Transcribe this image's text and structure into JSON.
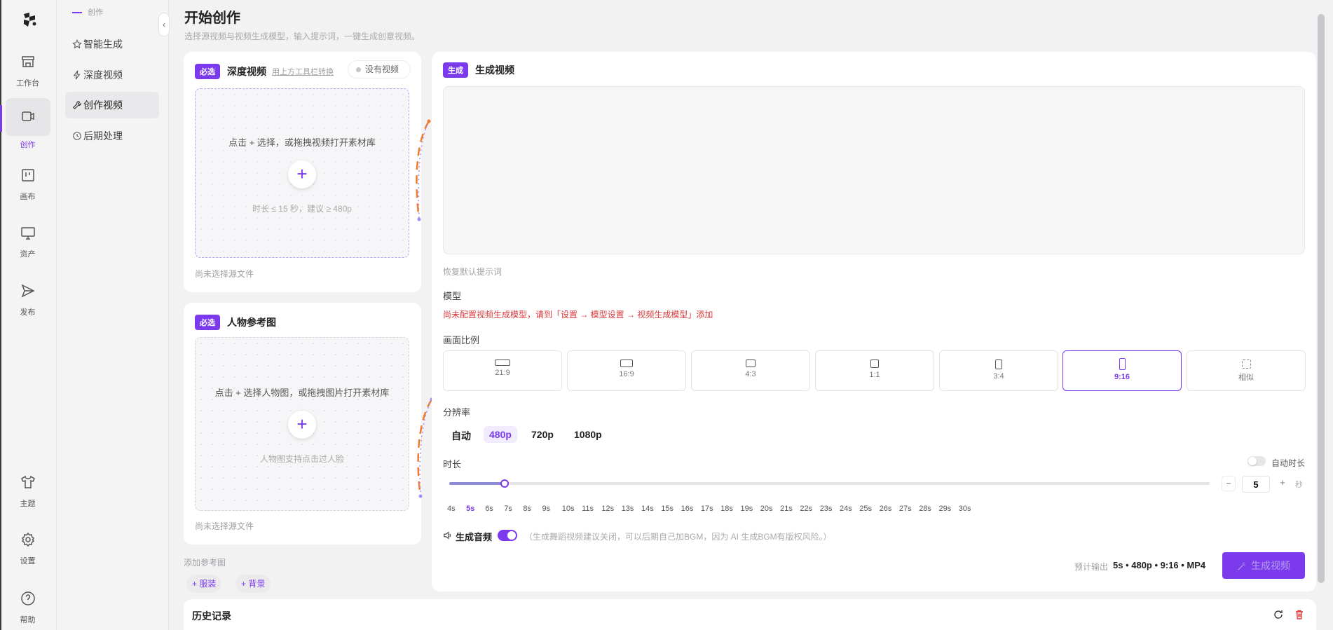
{
  "rail": {
    "items": [
      {
        "label": "工作台",
        "icon": "store-icon"
      },
      {
        "label": "创作",
        "icon": "video-icon",
        "active": true
      },
      {
        "label": "画布",
        "icon": "canvas-icon"
      },
      {
        "label": "资产",
        "icon": "monitor-icon"
      },
      {
        "label": "发布",
        "icon": "send-icon"
      }
    ],
    "bottom": [
      {
        "label": "主题",
        "icon": "shirt-icon"
      },
      {
        "label": "设置",
        "icon": "gear-icon"
      },
      {
        "label": "帮助",
        "icon": "help-icon"
      }
    ]
  },
  "subnav": {
    "section": "创作",
    "items": [
      {
        "label": "智能生成",
        "icon": "star-icon"
      },
      {
        "label": "深度视频",
        "icon": "bolt-icon"
      },
      {
        "label": "创作视频",
        "icon": "wrench-icon",
        "active": true
      },
      {
        "label": "后期处理",
        "icon": "clock-icon"
      }
    ],
    "collapse_glyph": "‹"
  },
  "header": {
    "title": "开始创作",
    "subtitle": "选择源视频与视频生成模型，输入提示词，一键生成创意视频。"
  },
  "source_card": {
    "tag": "必选",
    "title": "深度视频",
    "link": "用上方工具栏转换",
    "status": "没有视频",
    "drop_text": "点击 + 选择，或拖拽视频打开素材库",
    "drop_hint": "时长 ≤ 15 秒，建议 ≥ 480p",
    "footer": "尚未选择源文件"
  },
  "person_card": {
    "tag": "必选",
    "title": "人物参考图",
    "drop_text": "点击 + 选择人物图，或拖拽图片打开素材库",
    "drop_hint": "人物图支持点击过人脸",
    "footer": "尚未选择源文件"
  },
  "extra_refs": {
    "label": "添加参考图",
    "buttons": [
      "服装",
      "背景"
    ]
  },
  "generate": {
    "tag": "生成",
    "title": "生成视频",
    "prompt_value": "",
    "reset_prompt": "恢复默认提示词",
    "model_label": "模型",
    "model_warning": "尚未配置视频生成模型，请到「设置 → 模型设置 → 视频生成模型」添加",
    "ratio_label": "画面比例",
    "ratios": [
      "21:9",
      "16:9",
      "4:3",
      "1:1",
      "3:4",
      "9:16",
      "相似"
    ],
    "ratio_selected": "9:16",
    "resolution_label": "分辨率",
    "resolutions": [
      "自动",
      "480p",
      "720p",
      "1080p"
    ],
    "resolution_selected": "480p",
    "duration_label": "时长",
    "auto_duration_label": "自动时长",
    "auto_duration_on": false,
    "duration_value": "5",
    "duration_unit": "秒",
    "duration_min": 4,
    "duration_max": 30,
    "duration_ticks": [
      "4s",
      "5s",
      "6s",
      "7s",
      "8s",
      "9s",
      "10s",
      "11s",
      "12s",
      "13s",
      "14s",
      "15s",
      "16s",
      "17s",
      "18s",
      "19s",
      "20s",
      "21s",
      "22s",
      "23s",
      "24s",
      "25s",
      "26s",
      "27s",
      "28s",
      "29s",
      "30s"
    ],
    "duration_selected": "5s",
    "audio_label": "生成音频",
    "audio_on": true,
    "audio_hint": "（生成舞蹈视频建议关闭，可以后期自己加BGM，因为 AI 生成BGM有版权风险。）",
    "output_label": "预计输出",
    "output_value": "5s • 480p • 9:16 • MP4",
    "button": "生成视频"
  },
  "history": {
    "title": "历史记录"
  },
  "colors": {
    "accent": "#7c3aed",
    "warning": "#d9383a",
    "connector_orange": "#f07b2b",
    "connector_purple": "#a78bfa"
  }
}
